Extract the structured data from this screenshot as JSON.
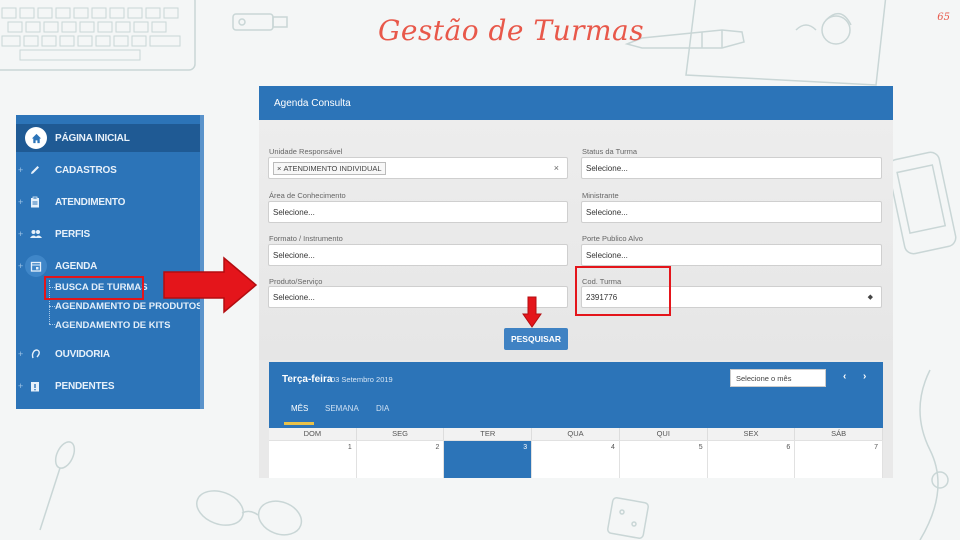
{
  "slide": {
    "title": "Gestão de Turmas",
    "page_number": "65"
  },
  "sidebar": {
    "items": [
      {
        "label": "PÁGINA INICIAL",
        "icon": "home-icon"
      },
      {
        "label": "CADASTROS",
        "icon": "pencil-icon"
      },
      {
        "label": "ATENDIMENTO",
        "icon": "clipboard-icon"
      },
      {
        "label": "PERFIS",
        "icon": "people-icon"
      },
      {
        "label": "AGENDA",
        "icon": "calendar-icon"
      },
      {
        "label": "OUVIDORIA",
        "icon": "ear-icon"
      },
      {
        "label": "PENDENTES",
        "icon": "clipboard-alert-icon"
      }
    ],
    "agenda_sub": [
      "BUSCA DE TURMAS",
      "AGENDAMENTO DE PRODUTOS",
      "AGENDAMENTO DE KITS"
    ]
  },
  "panel": {
    "title": "Agenda Consulta",
    "fields": {
      "unidade_label": "Unidade Responsável",
      "unidade_tag": "ATENDIMENTO INDIVIDUAL",
      "status_label": "Status da Turma",
      "status_value": "Selecione...",
      "area_label": "Área de Conhecimento",
      "area_value": "Selecione...",
      "ministrante_label": "Ministrante",
      "ministrante_value": "Selecione...",
      "formato_label": "Formato / Instrumento",
      "formato_value": "Selecione...",
      "porte_label": "Porte Publico Alvo",
      "porte_value": "Selecione...",
      "produto_label": "Produto/Serviço",
      "produto_value": "Selecione...",
      "cod_label": "Cod. Turma",
      "cod_value": "2391776"
    },
    "search_button": "PESQUISAR"
  },
  "calendar": {
    "day_name": "Terça-feira",
    "date": "03 Setembro 2019",
    "month_select": "Selecione o mês",
    "tabs": [
      "MÊS",
      "SEMANA",
      "DIA"
    ],
    "weekdays": [
      "DOM",
      "SEG",
      "TER",
      "QUA",
      "QUI",
      "SEX",
      "SÁB"
    ],
    "days": [
      "1",
      "2",
      "3",
      "4",
      "5",
      "6",
      "7"
    ],
    "today_index": 2
  }
}
